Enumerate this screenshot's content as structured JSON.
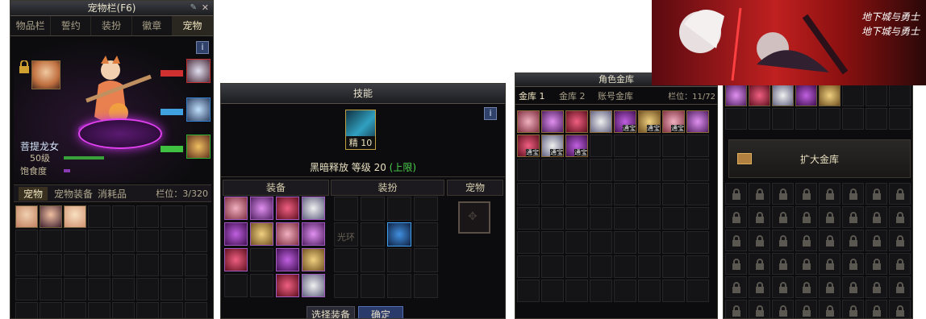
{
  "pet_panel": {
    "title": "宠物栏(F6)",
    "tabs": [
      "物品栏",
      "誓约",
      "装扮",
      "徽章",
      "宠物"
    ],
    "active_tab": 4,
    "info_label": "i",
    "pet_name": "菩提龙女",
    "pet_level": "50级",
    "satiety_label": "饱食度",
    "sub_tabs": [
      "宠物",
      "宠物装备",
      "消耗品"
    ],
    "slots_label": "栏位：3/320"
  },
  "skill_panel": {
    "title": "技能",
    "info_label": "i",
    "skill_badge": "精 10",
    "skill_name": "黑暗释放 等级 20",
    "skill_limit": "(上限)",
    "sections": [
      "装备",
      "装扮",
      "宠物"
    ],
    "halo_label": "光环",
    "select_button": "选择装备",
    "confirm_button": "确定",
    "colors": {
      "limit": "#4cd04c"
    }
  },
  "vault_panel": {
    "title": "角色金库",
    "tabs": [
      "金库 1",
      "金库 2",
      "账号金库"
    ],
    "slots_label": "栏位：11/72",
    "item_tags": [
      "通宝",
      "通宝",
      "通宝",
      "通宝",
      "通宝",
      "通宝"
    ]
  },
  "expand_panel": {
    "expand_button": "扩大金库"
  },
  "banner": {
    "logo_line1": "地下城与勇士",
    "logo_line2": "地下城与勇士"
  },
  "colors": {
    "accent": "#e0b040",
    "panel_bg": "#0c0c0e",
    "hp_green": "#3aa03a",
    "satiety_purple": "#8a3ab0"
  }
}
